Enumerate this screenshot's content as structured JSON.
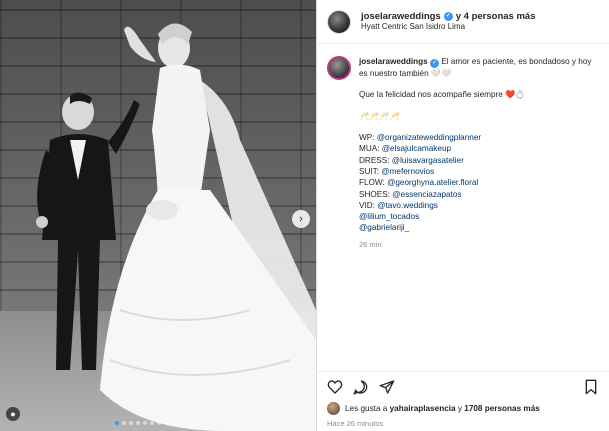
{
  "post": {
    "username": "joselaraweddings",
    "coauthors": "y 4 personas más",
    "location": "Hyatt Centric San Isidro Lima",
    "more_icon": "ellipsis-icon"
  },
  "caption": {
    "username": "joselaraweddings",
    "line1": "El amor es paciente, es bondadoso y hoy es nuestro también 🤍🤍",
    "line2": "Que la felicidad nos acompañe siempre ❤️💍",
    "line3": "🥂🥂🥂🥂",
    "credits": [
      {
        "label": "WP: ",
        "handle": "@organizateweddingplanner"
      },
      {
        "label": "MUA: ",
        "handle": "@elsajulcamakeup"
      },
      {
        "label": "DRESS: ",
        "handle": "@luisavargasatelier"
      },
      {
        "label": "SUIT: ",
        "handle": "@mefernovios"
      },
      {
        "label": "FLOW: ",
        "handle": "@georghyna.atelier.floral"
      },
      {
        "label": "SHOES: ",
        "handle": "@essenciazapatos"
      },
      {
        "label": "VID: ",
        "handle": "@tavo.weddings"
      },
      {
        "label": "",
        "handle": "@lilium_tocados"
      },
      {
        "label": "",
        "handle": "@gabrielariji_"
      }
    ],
    "time": "26 min"
  },
  "footer": {
    "likes_prefix": "Les gusta a ",
    "likes_user": "yahairaplasencia",
    "likes_mid": " y ",
    "likes_count": "1708 personas más",
    "ago": "Hace 26 minutos"
  },
  "icons": [
    "heart-icon",
    "comment-icon",
    "share-icon",
    "bookmark-icon",
    "next-arrow-icon",
    "tag-icon"
  ],
  "colors": {
    "link": "#00376b",
    "verified": "#3897f0",
    "muted": "#8e8e8e"
  }
}
